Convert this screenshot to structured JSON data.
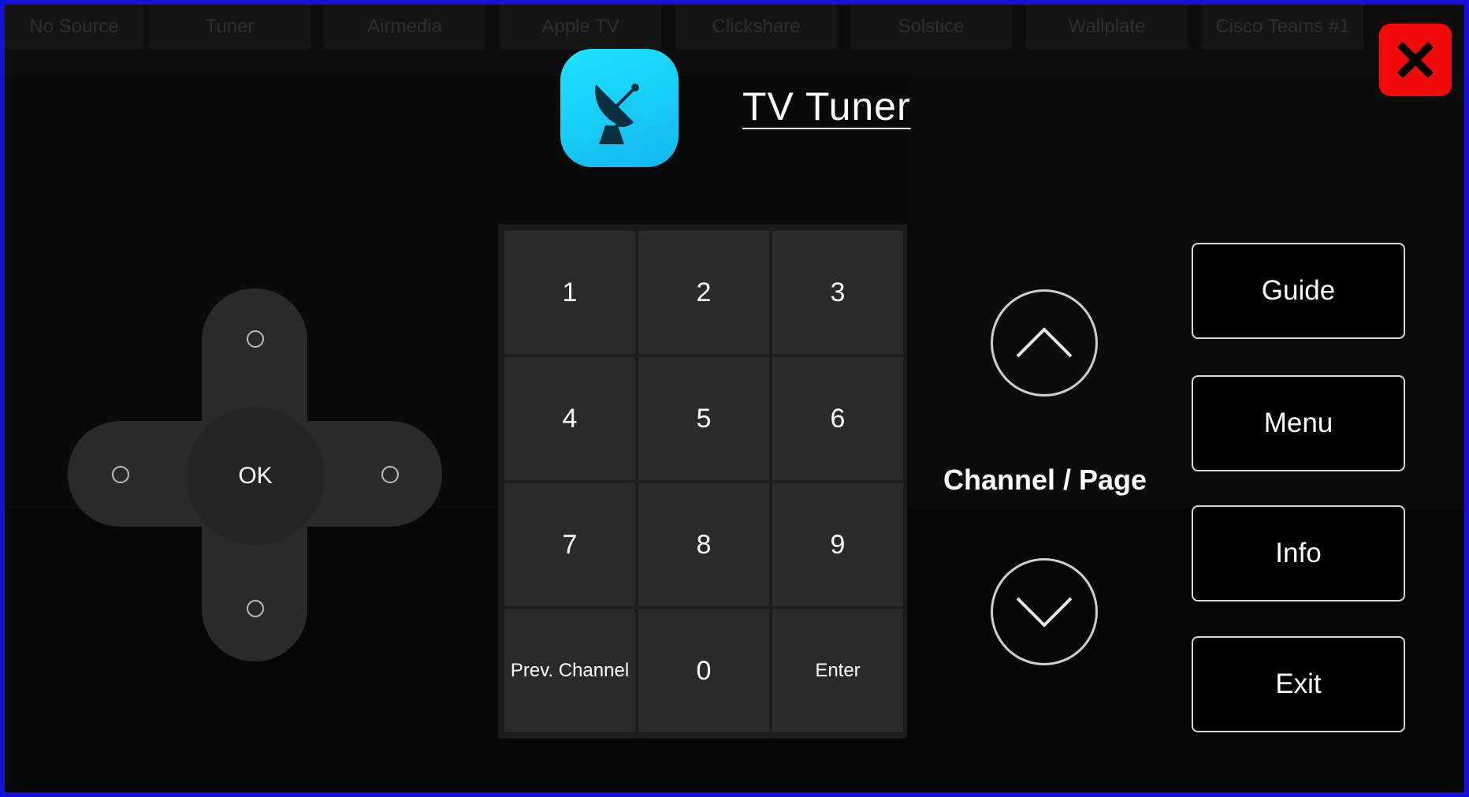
{
  "source_bar": {
    "tabs": [
      "No Source",
      "Tuner",
      "Airmedia",
      "Apple TV",
      "Clickshare",
      "Solstice",
      "Wallplate",
      "Cisco Teams #1"
    ]
  },
  "header": {
    "title": "TV Tuner",
    "icon": "satellite-dish-icon"
  },
  "close_button": {
    "icon": "close-icon"
  },
  "dpad": {
    "ok_label": "OK"
  },
  "keypad": {
    "keys": [
      "1",
      "2",
      "3",
      "4",
      "5",
      "6",
      "7",
      "8",
      "9",
      "Prev. Channel",
      "0",
      "Enter"
    ]
  },
  "channel": {
    "label": "Channel / Page",
    "up_icon": "chevron-up-icon",
    "down_icon": "chevron-down-icon"
  },
  "functions": {
    "guide": "Guide",
    "menu": "Menu",
    "info": "Info",
    "exit": "Exit"
  },
  "colors": {
    "frame_border": "#1410d8",
    "close_red": "#f20a0a",
    "icon_cyan": "#16c8f4"
  }
}
